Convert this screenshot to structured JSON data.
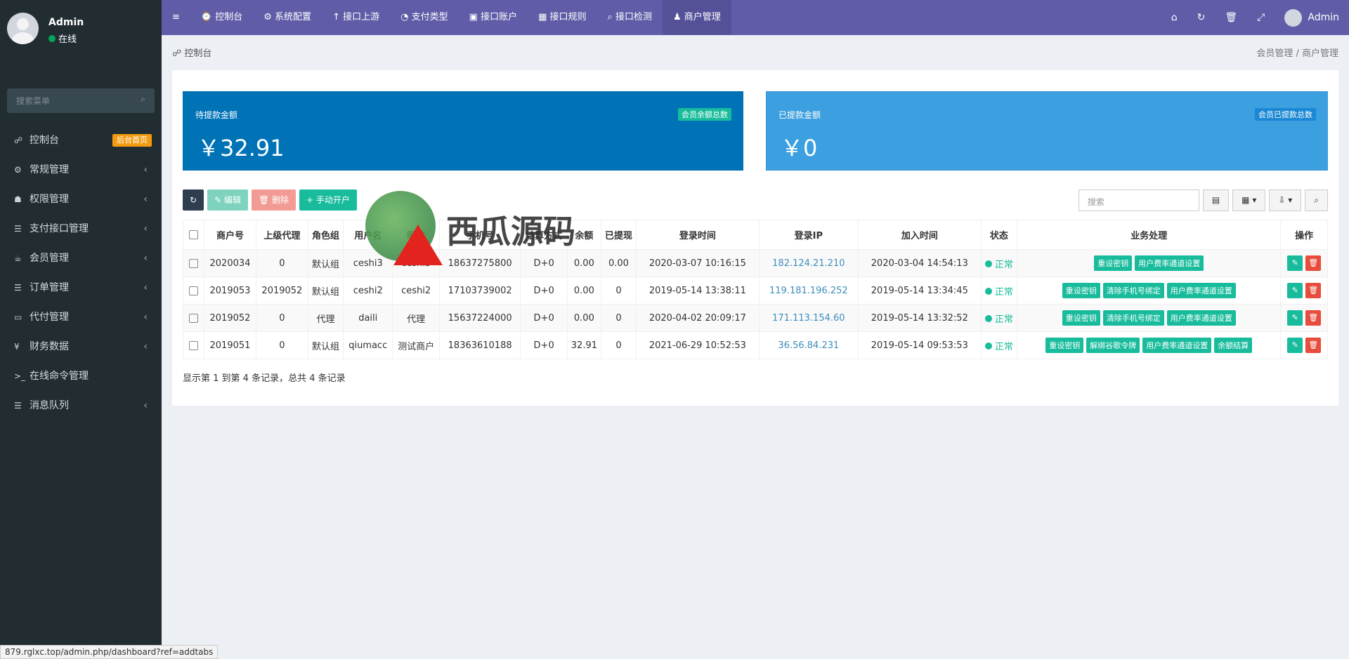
{
  "sidebar": {
    "user": "Admin",
    "status": "在线",
    "search_placeholder": "搜索菜单",
    "items": [
      {
        "icon": "☍",
        "label": "控制台",
        "badge": "后台首页"
      },
      {
        "icon": "⚙",
        "label": "常规管理",
        "arrow": "‹"
      },
      {
        "icon": "☗",
        "label": "权限管理",
        "arrow": "‹"
      },
      {
        "icon": "☰",
        "label": "支付接口管理",
        "arrow": "‹"
      },
      {
        "icon": "☕",
        "label": "会员管理",
        "arrow": "‹"
      },
      {
        "icon": "☰",
        "label": "订单管理",
        "arrow": "‹"
      },
      {
        "icon": "▭",
        "label": "代付管理",
        "arrow": "‹"
      },
      {
        "icon": "¥",
        "label": "财务数据",
        "arrow": "‹"
      },
      {
        "icon": ">_",
        "label": "在线命令管理"
      },
      {
        "icon": "☰",
        "label": "消息队列",
        "arrow": "‹"
      }
    ]
  },
  "topnav": {
    "items": [
      "控制台",
      "系统配置",
      "接口上游",
      "支付类型",
      "接口账户",
      "接口规则",
      "接口检测",
      "商户管理"
    ],
    "user": "Admin"
  },
  "breadcrumb": {
    "left": "控制台",
    "right": "会员管理 / 商户管理"
  },
  "stats": [
    {
      "label": "待提款金额",
      "value": "￥32.91",
      "tag": "会员余额总数"
    },
    {
      "label": "已提款金额",
      "value": "￥0",
      "tag": "会员已提款总数"
    }
  ],
  "toolbar": {
    "edit": "编辑",
    "delete": "删除",
    "add": "手动开户",
    "search_placeholder": "搜索"
  },
  "table": {
    "headers": [
      "商户号",
      "上级代理",
      "角色组",
      "用户名",
      "昵称",
      "手机号",
      "结算方式",
      "余额",
      "已提现",
      "登录时间",
      "登录IP",
      "加入时间",
      "状态",
      "业务处理",
      "操作"
    ],
    "rows": [
      [
        "2020034",
        "0",
        "默认组",
        "ceshi3",
        "ceshi3",
        "18637275800",
        "D+0",
        "0.00",
        "0.00",
        "2020-03-07 10:16:15",
        "182.124.21.210",
        "2020-03-04 14:54:13",
        "正常"
      ],
      [
        "2019053",
        "2019052",
        "默认组",
        "ceshi2",
        "ceshi2",
        "17103739002",
        "D+0",
        "0.00",
        "0",
        "2019-05-14 13:38:11",
        "119.181.196.252",
        "2019-05-14 13:34:45",
        "正常"
      ],
      [
        "2019052",
        "0",
        "代理",
        "daili",
        "代理",
        "15637224000",
        "D+0",
        "0.00",
        "0",
        "2020-04-02 20:09:17",
        "171.113.154.60",
        "2019-05-14 13:32:52",
        "正常"
      ],
      [
        "2019051",
        "0",
        "默认组",
        "qiumacc",
        "测试商户",
        "18363610188",
        "D+0",
        "32.91",
        "0",
        "2021-06-29 10:52:53",
        "36.56.84.231",
        "2019-05-14 09:53:53",
        "正常"
      ]
    ],
    "ops": [
      [
        "重设密钥",
        "用户费率通道设置"
      ],
      [
        "重设密钥",
        "清除手机号绑定",
        "用户费率通道设置"
      ],
      [
        "重设密钥",
        "清除手机号绑定",
        "用户费率通道设置"
      ],
      [
        "重设密钥",
        "解绑谷歌令牌",
        "用户费率通道设置",
        "余额结算"
      ]
    ]
  },
  "footer": "显示第 1 到第 4 条记录，总共 4 条记录",
  "statusbar": "879.rglxc.top/admin.php/dashboard?ref=addtabs",
  "watermark": "西瓜源码"
}
